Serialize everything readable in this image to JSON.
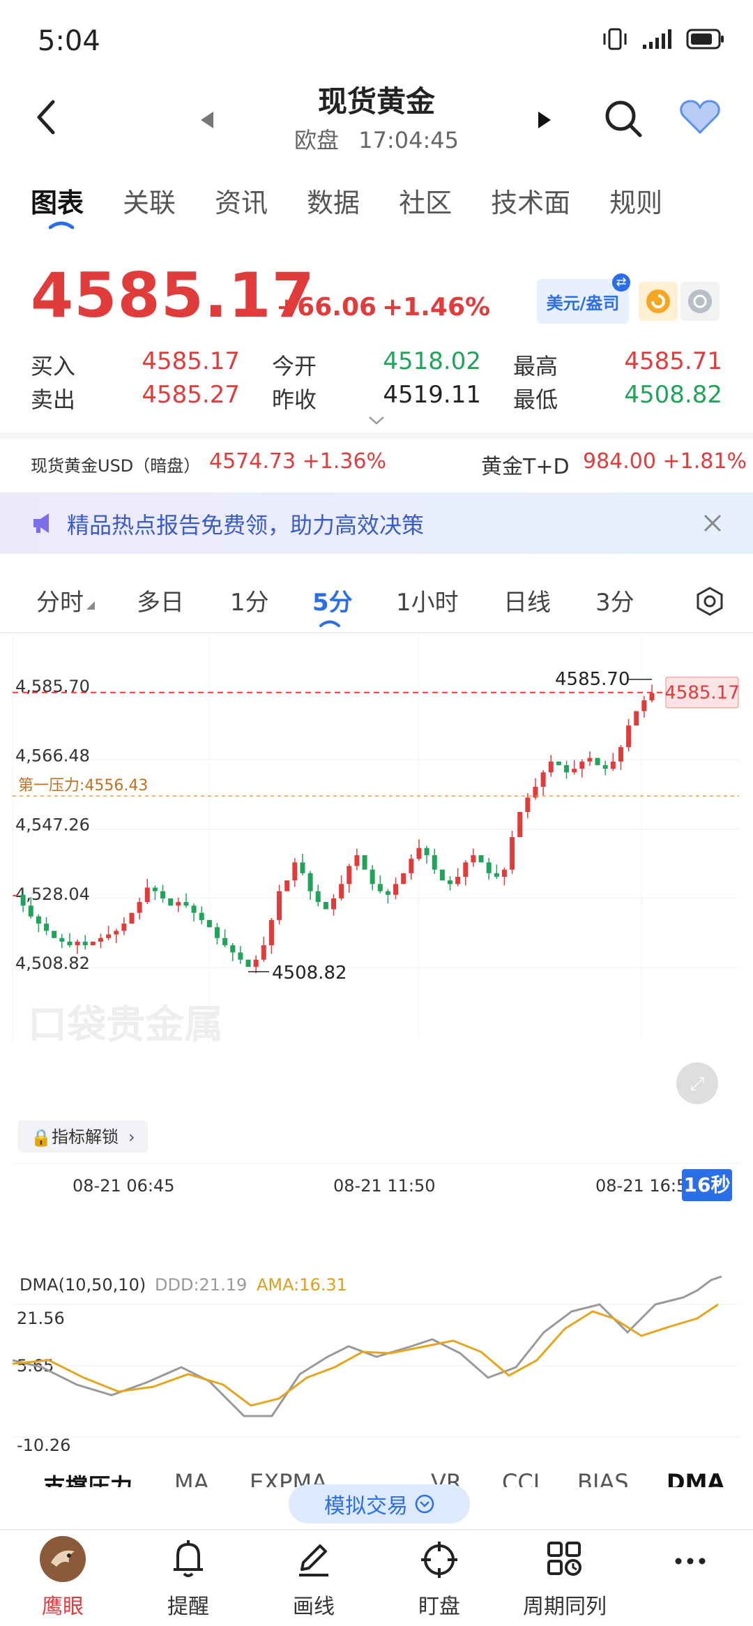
{
  "status": {
    "time": "5:04"
  },
  "header": {
    "title": "现货黄金",
    "session": "欧盘",
    "clock": "17:04:45"
  },
  "tabs": [
    "图表",
    "关联",
    "资讯",
    "数据",
    "社区",
    "技术面",
    "规则"
  ],
  "quote": {
    "price": "4585.17",
    "change": "+66.06",
    "change_pct": "+1.46%",
    "currency_btn": "美元/盎司",
    "buy_label": "买入",
    "buy": "4585.17",
    "sell_label": "卖出",
    "sell": "4585.27",
    "open_label": "今开",
    "open": "4518.02",
    "prev_label": "昨收",
    "prev": "4519.11",
    "high_label": "最高",
    "high": "4585.71",
    "low_label": "最低",
    "low": "4508.82"
  },
  "related": {
    "left_name": "现货黄金USD（暗盘）",
    "left_val": "4574.73 +1.36%",
    "right_name": "黄金T+D",
    "right_val": "984.00 +1.81%"
  },
  "banner": {
    "text": "精品热点报告免费领，助力高效决策"
  },
  "chart_tabs": [
    "分时",
    "多日",
    "1分",
    "5分",
    "1小时",
    "日线",
    "3分"
  ],
  "chart": {
    "current_price_tag": "4585.17",
    "high_label": "4585.70",
    "low_label": "4508.82",
    "resistance_label": "第一压力:4556.43",
    "y_ticks": [
      "4,585.70",
      "4,566.48",
      "4,547.26",
      "4,528.04",
      "4,508.82"
    ],
    "x_ticks": [
      "08-21 06:45",
      "08-21 11:50",
      "08-21 16:5"
    ],
    "watermark": "口袋贵金属",
    "lock_btn": "指标解锁",
    "countdown": "16秒",
    "colors": {
      "up": "#e03c3c",
      "down": "#1fa45a",
      "accent": "#2b6fe8"
    }
  },
  "indicator": {
    "name": "DMA(10,50,10)",
    "ddd": "DDD:21.19",
    "ama": "AMA:16.31",
    "y_ticks": [
      "21.56",
      "5.65",
      "-10.26"
    ]
  },
  "indicator_tabs": [
    "支撑压力",
    "MA",
    "EXPMA",
    "VR",
    "CCI",
    "BIAS",
    "DMA"
  ],
  "sim_trade": "模拟交易",
  "bottom_nav": [
    "鹰眼",
    "提醒",
    "画线",
    "盯盘",
    "周期同列"
  ],
  "chart_data": {
    "type": "candlestick",
    "ylim": [
      4508.82,
      4585.7
    ],
    "resistance": 4556.43,
    "close_series": [
      4529,
      4526,
      4523,
      4521,
      4519,
      4517,
      4516,
      4515,
      4516,
      4515,
      4516,
      4517,
      4518,
      4519,
      4521,
      4524,
      4527,
      4531,
      4530,
      4528,
      4526,
      4527,
      4526,
      4524,
      4522,
      4520,
      4517,
      4515,
      4513,
      4511,
      4509,
      4511,
      4515,
      4522,
      4530,
      4533,
      4538,
      4535,
      4530,
      4527,
      4525,
      4528,
      4532,
      4537,
      4540,
      4536,
      4532,
      4530,
      4529,
      4532,
      4535,
      4539,
      4542,
      4540,
      4536,
      4533,
      4532,
      4534,
      4538,
      4540,
      4538,
      4535,
      4534,
      4536,
      4545,
      4552,
      4556,
      4559,
      4563,
      4566,
      4565,
      4563,
      4564,
      4566,
      4567,
      4565,
      4564,
      4566,
      4570,
      4576,
      4580,
      4583,
      4585
    ]
  }
}
